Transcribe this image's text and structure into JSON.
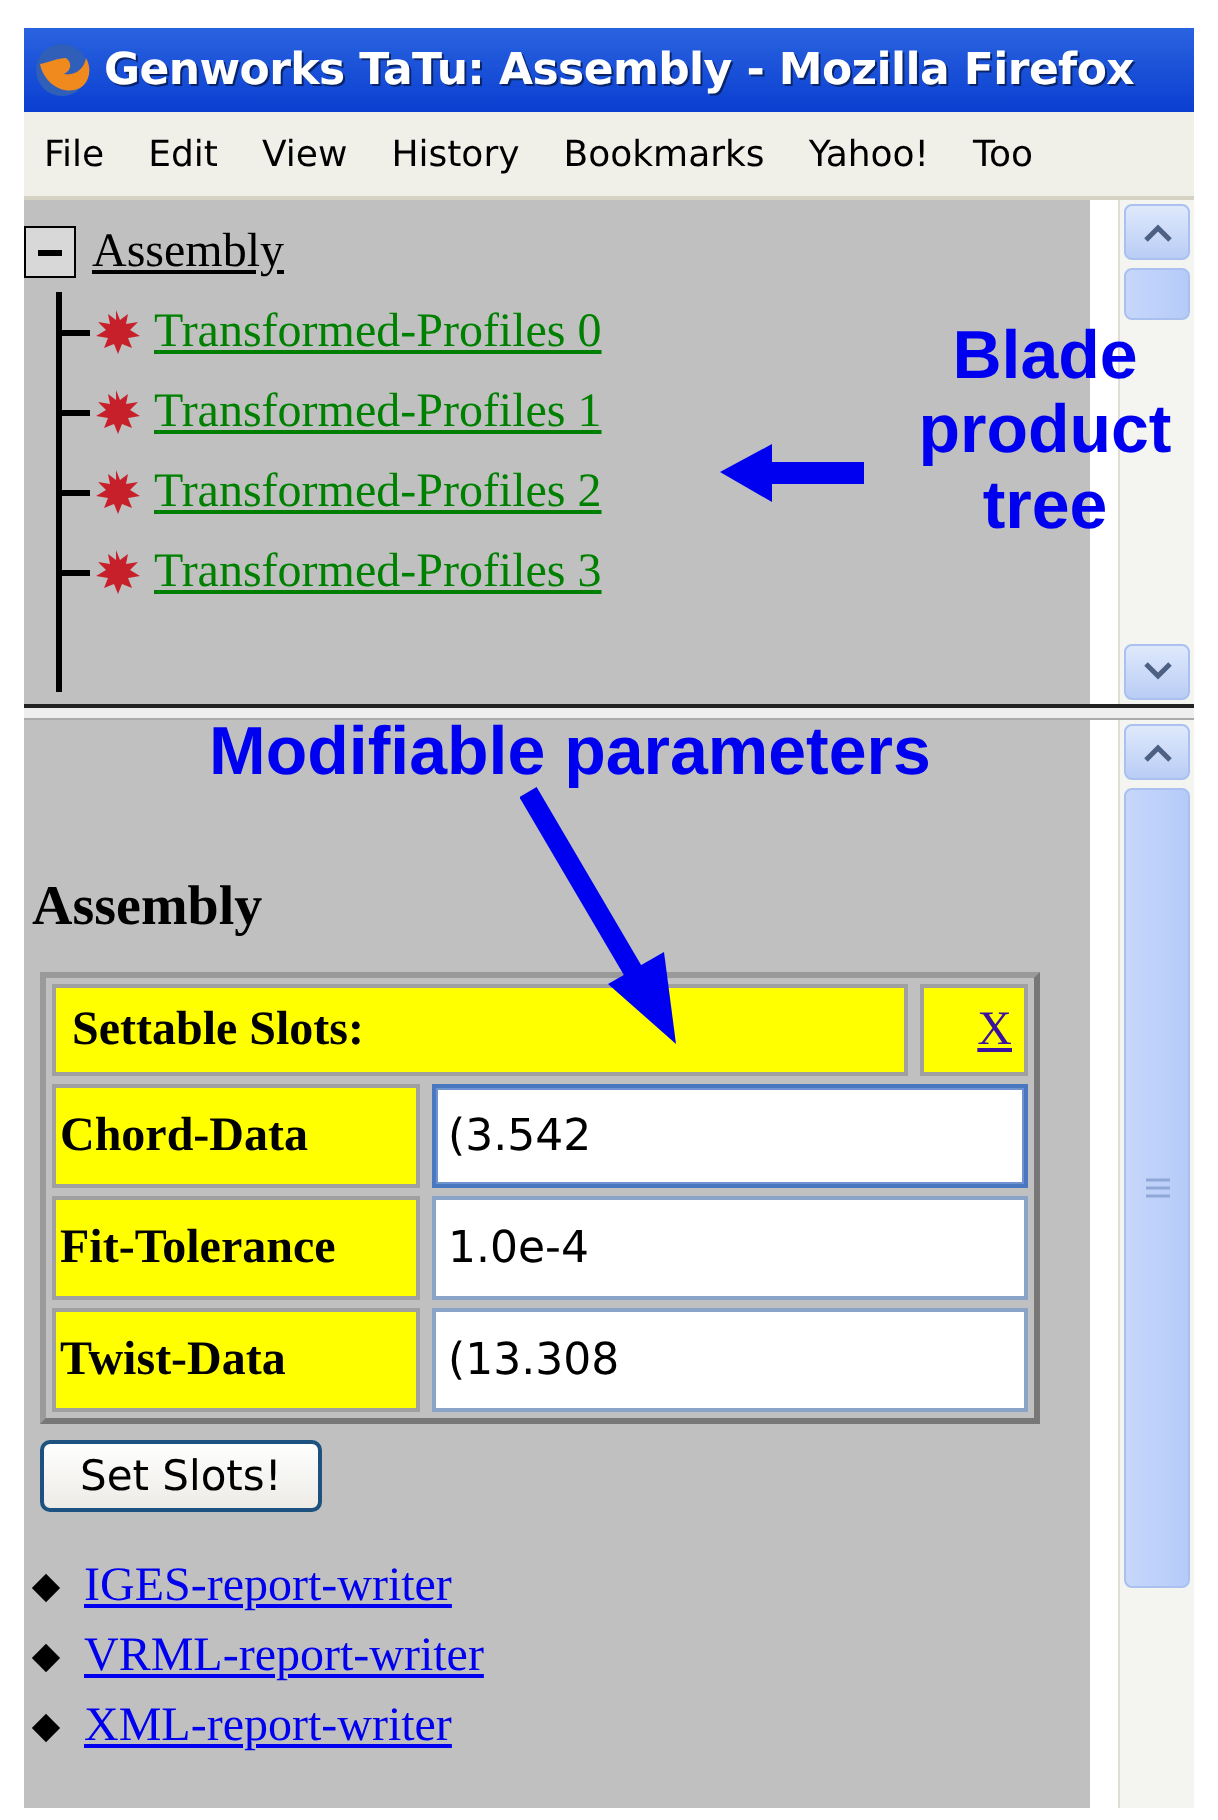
{
  "window": {
    "title": "Genworks TaTu: Assembly - Mozilla Firefox"
  },
  "menu": [
    "File",
    "Edit",
    "View",
    "History",
    "Bookmarks",
    "Yahoo!",
    "Too"
  ],
  "tree": {
    "label": "Assembly",
    "expanded": true,
    "children": [
      {
        "label": "Transformed-Profiles 0"
      },
      {
        "label": "Transformed-Profiles 1"
      },
      {
        "label": "Transformed-Profiles 2"
      },
      {
        "label": "Transformed-Profiles 3"
      }
    ]
  },
  "annotations": [
    {
      "kind": "side",
      "text": "Blade product tree"
    },
    {
      "kind": "top",
      "text": "Modifiable parameters"
    }
  ],
  "heading": "Assembly",
  "slots_table": {
    "title": "Settable Slots:",
    "close": "X",
    "rows": [
      {
        "label": "Chord-Data",
        "value": "(3.542",
        "focused": true
      },
      {
        "label": "Fit-Tolerance",
        "value": "1.0e-4",
        "focused": false
      },
      {
        "label": "Twist-Data",
        "value": "(13.308",
        "focused": false
      }
    ]
  },
  "submit": "Set Slots!",
  "links": [
    "IGES-report-writer",
    "VRML-report-writer",
    "XML-report-writer"
  ]
}
